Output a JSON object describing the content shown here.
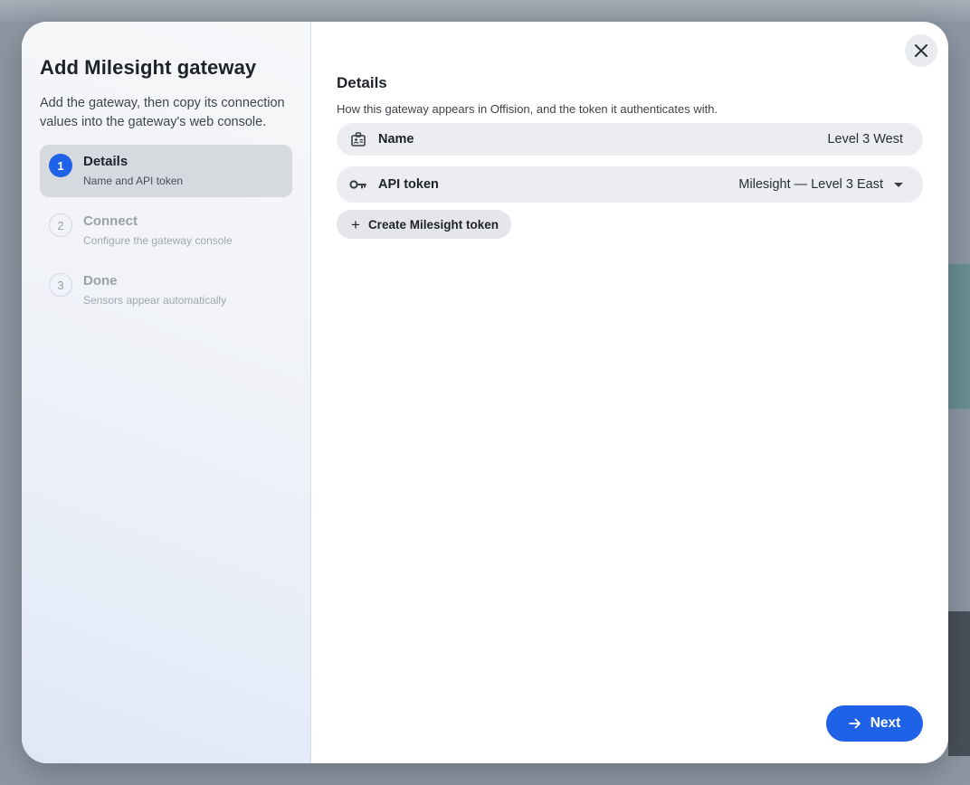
{
  "sidebar": {
    "title": "Add Milesight gateway",
    "description": "Add the gateway, then copy its connection values into the gateway's web console.",
    "steps": [
      {
        "number": "1",
        "label": "Details",
        "sub": "Name and API token",
        "state": "active"
      },
      {
        "number": "2",
        "label": "Connect",
        "sub": "Configure the gateway console",
        "state": "inactive"
      },
      {
        "number": "3",
        "label": "Done",
        "sub": "Sensors appear automatically",
        "state": "inactive"
      }
    ]
  },
  "main": {
    "section_title": "Details",
    "section_description": "How this gateway appears in Offision, and the token it authenticates with.",
    "name_field": {
      "label": "Name",
      "value": "Level 3 West",
      "icon": "id-card-icon"
    },
    "token_field": {
      "label": "API token",
      "value": "Milesight — Level 3 East",
      "icon": "key-icon"
    },
    "create_token_label": "Create Milesight token",
    "next_label": "Next"
  },
  "colors": {
    "accent": "#1f62e8",
    "field_bg": "#ebedf0",
    "active_step_bg": "#d6d9de"
  }
}
